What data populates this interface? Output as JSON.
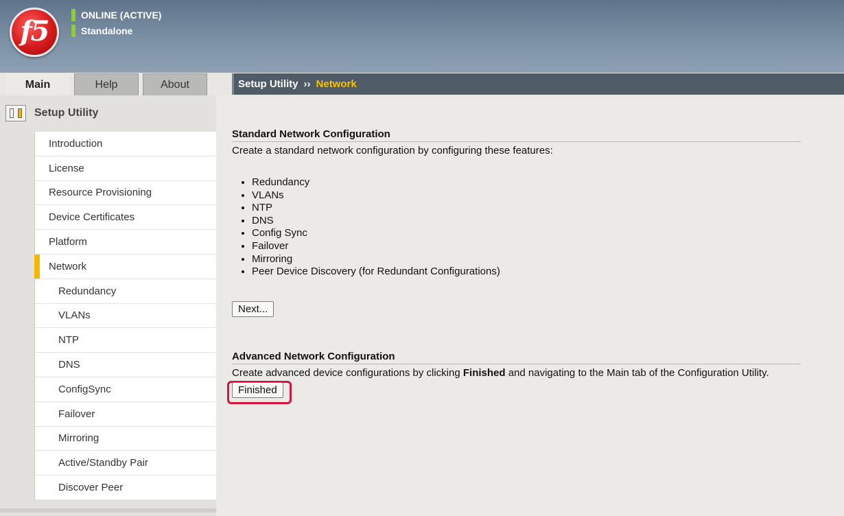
{
  "header": {
    "logo_text": "f5",
    "status_line1": "ONLINE (ACTIVE)",
    "status_line2": "Standalone",
    "status_color": "#8fcc3c",
    "brand_color": "#d41a1a"
  },
  "tabs": [
    {
      "label": "Main",
      "active": true
    },
    {
      "label": "Help",
      "active": false
    },
    {
      "label": "About",
      "active": false
    }
  ],
  "breadcrumb": {
    "root": "Setup Utility",
    "separator": "››",
    "current": "Network",
    "current_color": "#f9c200"
  },
  "sidebar": {
    "title": "Setup Utility",
    "icon": "setup-utility-icon",
    "items": [
      {
        "label": "Introduction"
      },
      {
        "label": "License"
      },
      {
        "label": "Resource Provisioning"
      },
      {
        "label": "Device Certificates"
      },
      {
        "label": "Platform"
      },
      {
        "label": "Network",
        "current": true
      },
      {
        "label": "Redundancy"
      },
      {
        "label": "VLANs"
      },
      {
        "label": "NTP"
      },
      {
        "label": "DNS"
      },
      {
        "label": "ConfigSync"
      },
      {
        "label": "Failover"
      },
      {
        "label": "Mirroring"
      },
      {
        "label": "Active/Standby Pair"
      },
      {
        "label": "Discover Peer"
      }
    ]
  },
  "standard": {
    "title": "Standard Network Configuration",
    "description": "Create a standard network configuration by configuring these features:",
    "features": [
      "Redundancy",
      "VLANs",
      "NTP",
      "DNS",
      "Config Sync",
      "Failover",
      "Mirroring",
      "Peer Device Discovery (for Redundant Configurations)"
    ],
    "next_label": "Next..."
  },
  "advanced": {
    "title": "Advanced Network Configuration",
    "desc_before": "Create advanced device configurations by clicking ",
    "desc_bold": "Finished",
    "desc_after": " and navigating to the Main tab of the Configuration Utility.",
    "finished_label": "Finished",
    "highlight_color": "#d6133a"
  }
}
